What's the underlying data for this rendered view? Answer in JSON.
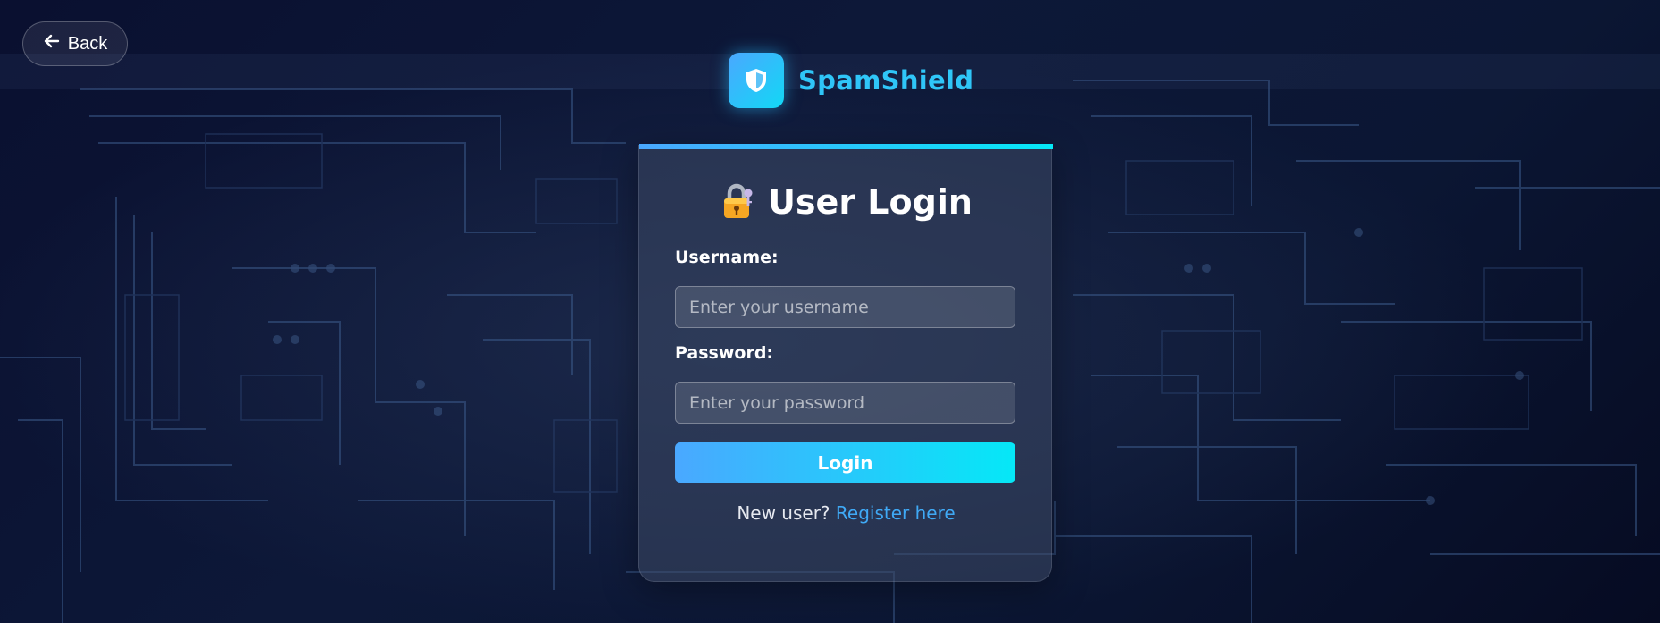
{
  "back": {
    "label": "Back",
    "icon": "arrow-left-icon"
  },
  "brand": {
    "name": "SpamShield",
    "icon": "shield-icon",
    "color": "#2fc6f8"
  },
  "card": {
    "title": "User Login",
    "title_icon": "lock-key-icon",
    "accent_gradient": [
      "#4aa8ff",
      "#05e8f7"
    ]
  },
  "form": {
    "username_label": "Username:",
    "username_placeholder": "Enter your username",
    "username_value": "",
    "password_label": "Password:",
    "password_placeholder": "Enter your password",
    "password_value": "",
    "submit_label": "Login"
  },
  "register": {
    "prompt": "New user?",
    "link_label": "Register here",
    "link_color": "#3fa9f5"
  }
}
